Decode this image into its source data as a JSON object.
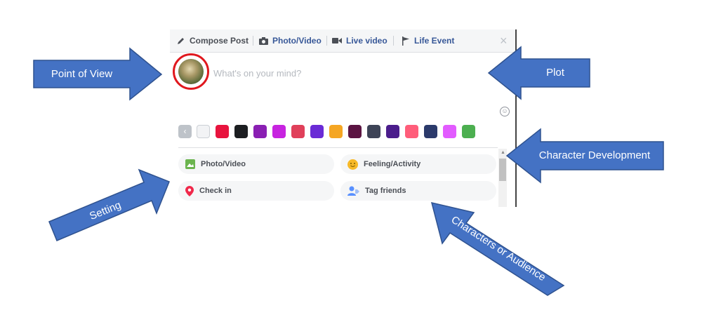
{
  "composer": {
    "tabs": {
      "compose": "Compose Post",
      "photo": "Photo/Video",
      "live": "Live video",
      "event": "Life Event"
    },
    "close": "×",
    "placeholder": "What's on your mind?",
    "back_glyph": "‹",
    "swatch_colors": [
      "#f2f3f5",
      "#e8143e",
      "#1c1e21",
      "#8a1fb3",
      "#c724e0",
      "#e0405a",
      "#6a2bd6",
      "#f5a623",
      "#5b1442",
      "#3e4457",
      "#4b1d8c",
      "#ff5d7a",
      "#2b3a6b",
      "#e25bff",
      "#4caf50"
    ],
    "options": {
      "photo": "Photo/Video",
      "feeling": "Feeling/Activity",
      "checkin": "Check in",
      "tag": "Tag friends"
    }
  },
  "annotations": {
    "point_of_view": "Point of View",
    "plot": "Plot",
    "character_development": "Character Development",
    "setting": "Setting",
    "characters_audience": "Characters or Audience"
  },
  "colors": {
    "arrow_fill": "#4472c4",
    "arrow_stroke": "#2f528f",
    "ring": "#e0181e",
    "link_blue": "#385898"
  }
}
